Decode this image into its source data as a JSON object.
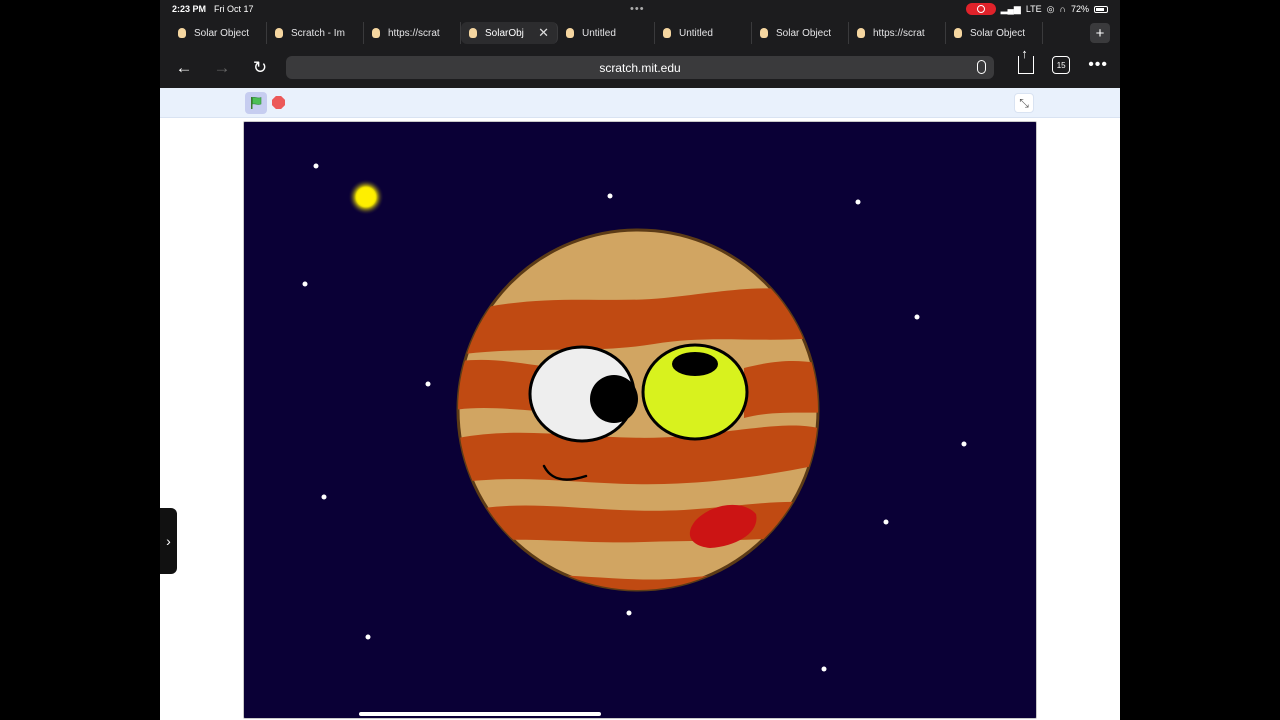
{
  "status": {
    "time": "2:23 PM",
    "date": "Fri Oct 17",
    "network": "LTE",
    "battery": "72%"
  },
  "tabs": [
    {
      "label": "Solar Object",
      "active": false
    },
    {
      "label": "Scratch - Im",
      "active": false
    },
    {
      "label": "https://scrat",
      "active": false
    },
    {
      "label": "SolarObj",
      "active": true
    },
    {
      "label": "Untitled",
      "active": false
    },
    {
      "label": "Untitled",
      "active": false
    },
    {
      "label": "Solar Object",
      "active": false
    },
    {
      "label": "https://scrat",
      "active": false
    },
    {
      "label": "Solar Object",
      "active": false
    }
  ],
  "toolbar": {
    "url": "scratch.mit.edu",
    "tab_count": "15"
  },
  "icons": {
    "back": "back-arrow-icon",
    "forward": "forward-arrow-icon",
    "reload": "reload-icon",
    "mic": "microphone-icon",
    "share": "share-icon",
    "more": "more-icon",
    "flag": "green-flag-icon",
    "stop": "stop-icon",
    "fullscreen": "exit-fullscreen-icon"
  },
  "colors": {
    "stage_bg": "#0a0036",
    "planet_base": "#d1a562",
    "planet_bands": "#c04a12",
    "eye_left": "#eeeeee",
    "eye_right": "#d8f21e",
    "spot": "#cc1414",
    "sun": "#ffef00"
  }
}
